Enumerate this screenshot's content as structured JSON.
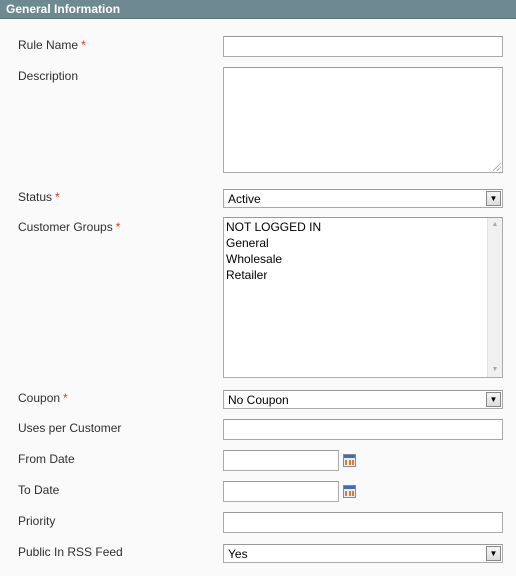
{
  "section": {
    "title": "General Information"
  },
  "fields": {
    "rule_name": {
      "label": "Rule Name",
      "required": "*",
      "value": ""
    },
    "description": {
      "label": "Description",
      "value": ""
    },
    "status": {
      "label": "Status",
      "required": "*",
      "value": "Active"
    },
    "customer_groups": {
      "label": "Customer Groups",
      "required": "*",
      "options": [
        "NOT LOGGED IN",
        "General",
        "Wholesale",
        "Retailer"
      ]
    },
    "coupon": {
      "label": "Coupon",
      "required": "*",
      "value": "No Coupon"
    },
    "uses_per_customer": {
      "label": "Uses per Customer",
      "value": ""
    },
    "from_date": {
      "label": "From Date",
      "value": ""
    },
    "to_date": {
      "label": "To Date",
      "value": ""
    },
    "priority": {
      "label": "Priority",
      "value": ""
    },
    "rss": {
      "label": "Public In RSS Feed",
      "value": "Yes"
    }
  },
  "icons": {
    "dropdown": "chevron-down-icon",
    "calendar": "calendar-icon",
    "scroll_up": "scroll-up-icon",
    "scroll_down": "scroll-down-icon"
  },
  "colors": {
    "header_bg": "#6f8992",
    "required": "#eb340a",
    "page_bg": "#fafafa"
  }
}
